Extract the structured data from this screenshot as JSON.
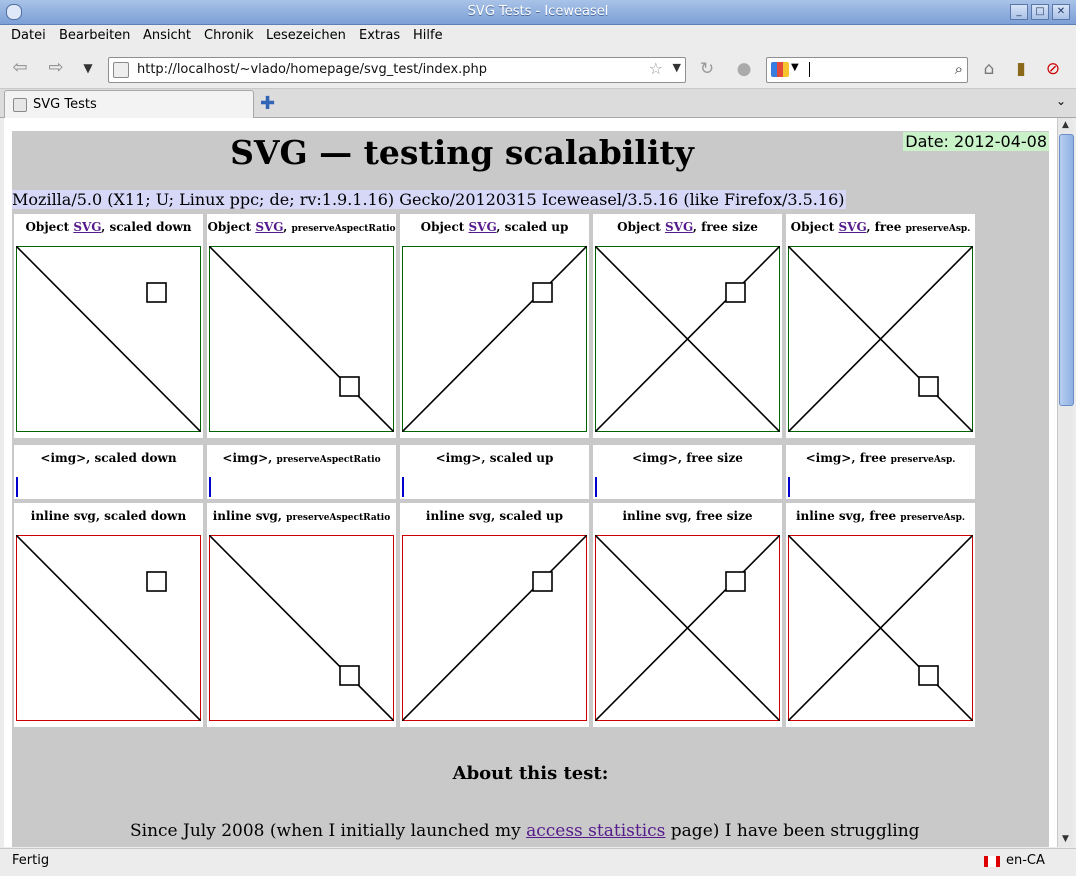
{
  "window": {
    "title": "SVG Tests - Iceweasel"
  },
  "menu": [
    "Datei",
    "Bearbeiten",
    "Ansicht",
    "Chronik",
    "Lesezeichen",
    "Extras",
    "Hilfe"
  ],
  "address": {
    "url": "http://localhost/~vlado/homepage/svg_test/index.php"
  },
  "search": {
    "value": ""
  },
  "tabs": [
    {
      "label": "SVG Tests"
    }
  ],
  "page": {
    "title": "SVG — testing scalability",
    "date": "Date: 2012-04-08",
    "user_agent": "Mozilla/5.0 (X11; U; Linux ppc; de; rv:1.9.1.16) Gecko/20120315 Iceweasel/3.5.16 (like Firefox/3.5.16)",
    "object_link": "SVG",
    "object_row": [
      {
        "pre": "Object ",
        "post": ", scaled down",
        "small": ""
      },
      {
        "pre": "Object ",
        "post": ", ",
        "small": "preserveAspectRatio"
      },
      {
        "pre": "Object ",
        "post": ", scaled up",
        "small": ""
      },
      {
        "pre": "Object ",
        "post": ", free size",
        "small": ""
      },
      {
        "pre": "Object ",
        "post": ", free ",
        "small": "preserveAsp."
      }
    ],
    "img_row": [
      {
        "text": "<img>, scaled down",
        "small": ""
      },
      {
        "text": "<img>, ",
        "small": "preserveAspectRatio"
      },
      {
        "text": "<img>, scaled up",
        "small": ""
      },
      {
        "text": "<img>, free size",
        "small": ""
      },
      {
        "text": "<img>, free ",
        "small": "preserveAsp."
      }
    ],
    "inline_row": [
      {
        "text": "inline svg, scaled down",
        "small": ""
      },
      {
        "text": "inline svg, ",
        "small": "preserveAspectRatio"
      },
      {
        "text": "inline svg, scaled up",
        "small": ""
      },
      {
        "text": "inline svg, free size",
        "small": ""
      },
      {
        "text": "inline svg, free ",
        "small": "preserveAsp."
      }
    ],
    "about_heading": "About this test:",
    "para_before": "Since July 2008 (when I initially launched my ",
    "para_link": "access statistics",
    "para_after": " page) I have been struggling"
  },
  "status": {
    "text": "Fertig",
    "locale": "en-CA"
  },
  "colors": {
    "object_border": "#006400",
    "inline_border": "#cc0000",
    "img_bar": "#0000cc",
    "page_bg": "#c9c9c9",
    "date_bg": "#c9f2c9",
    "ua_bg": "#d7d7f8"
  }
}
